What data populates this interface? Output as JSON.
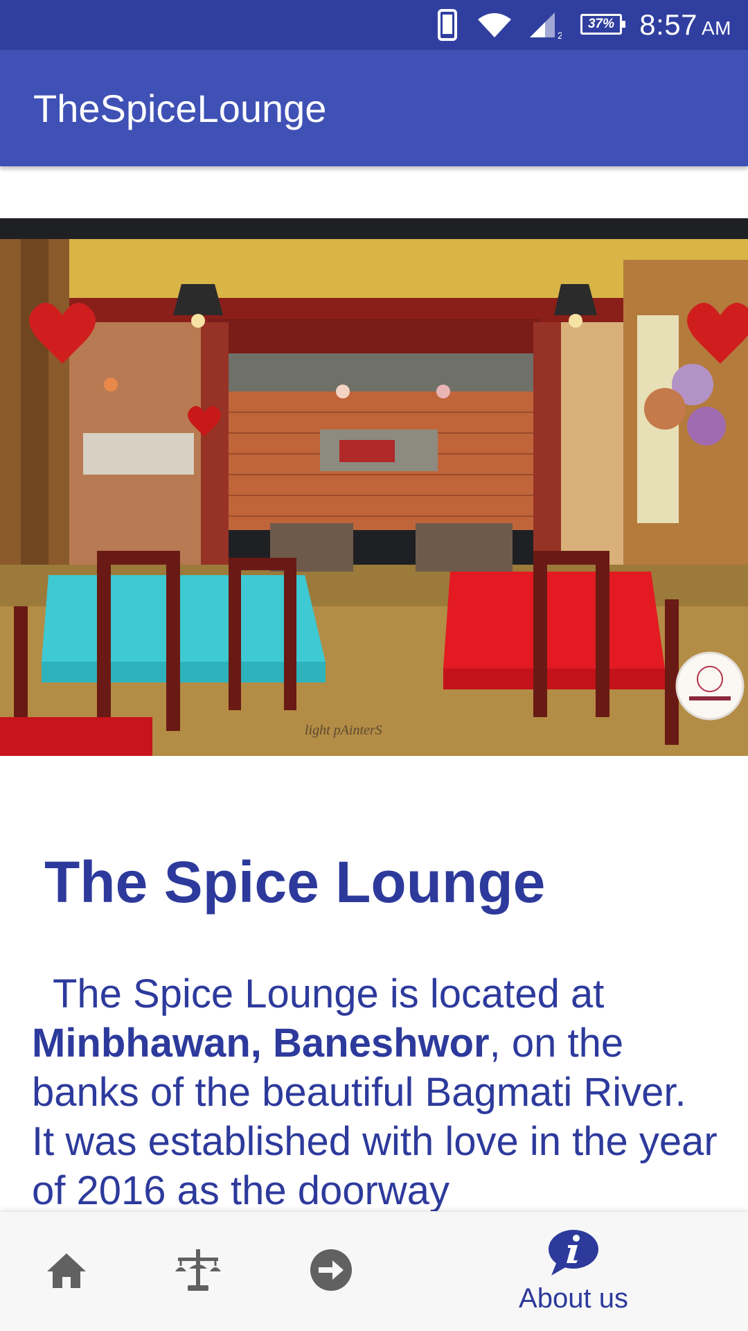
{
  "status_bar": {
    "battery": "37%",
    "time": "8:57",
    "ampm": "AM",
    "icons": [
      "phone-vibrate-icon",
      "wifi-icon",
      "cell-signal-icon",
      "battery-icon"
    ],
    "signal_sub": "2"
  },
  "app_bar": {
    "title": "TheSpiceLounge"
  },
  "hero": {
    "watermark": "light pAinterS"
  },
  "content": {
    "heading": "The Spice Lounge",
    "para_before": "The Spice Lounge is located at ",
    "para_bold": "Minbhawan, Baneshwor",
    "para_after": ", on the banks of the beautiful Bagmati River. It was established with love in the year of 2016 as the doorway"
  },
  "bottom_nav": {
    "items": [
      {
        "name": "home",
        "icon": "home-icon",
        "label": ""
      },
      {
        "name": "menu",
        "icon": "lamp-icon",
        "label": ""
      },
      {
        "name": "login",
        "icon": "arrow-right-circle-icon",
        "label": ""
      },
      {
        "name": "about",
        "icon": "info-bubble-icon",
        "label": "About us"
      }
    ],
    "active_color": "#2d3a9c",
    "inactive_color": "#616161"
  },
  "colors": {
    "status_bar": "#303f9f",
    "app_bar": "#3f51b5",
    "text_primary": "#2d3a9c"
  }
}
